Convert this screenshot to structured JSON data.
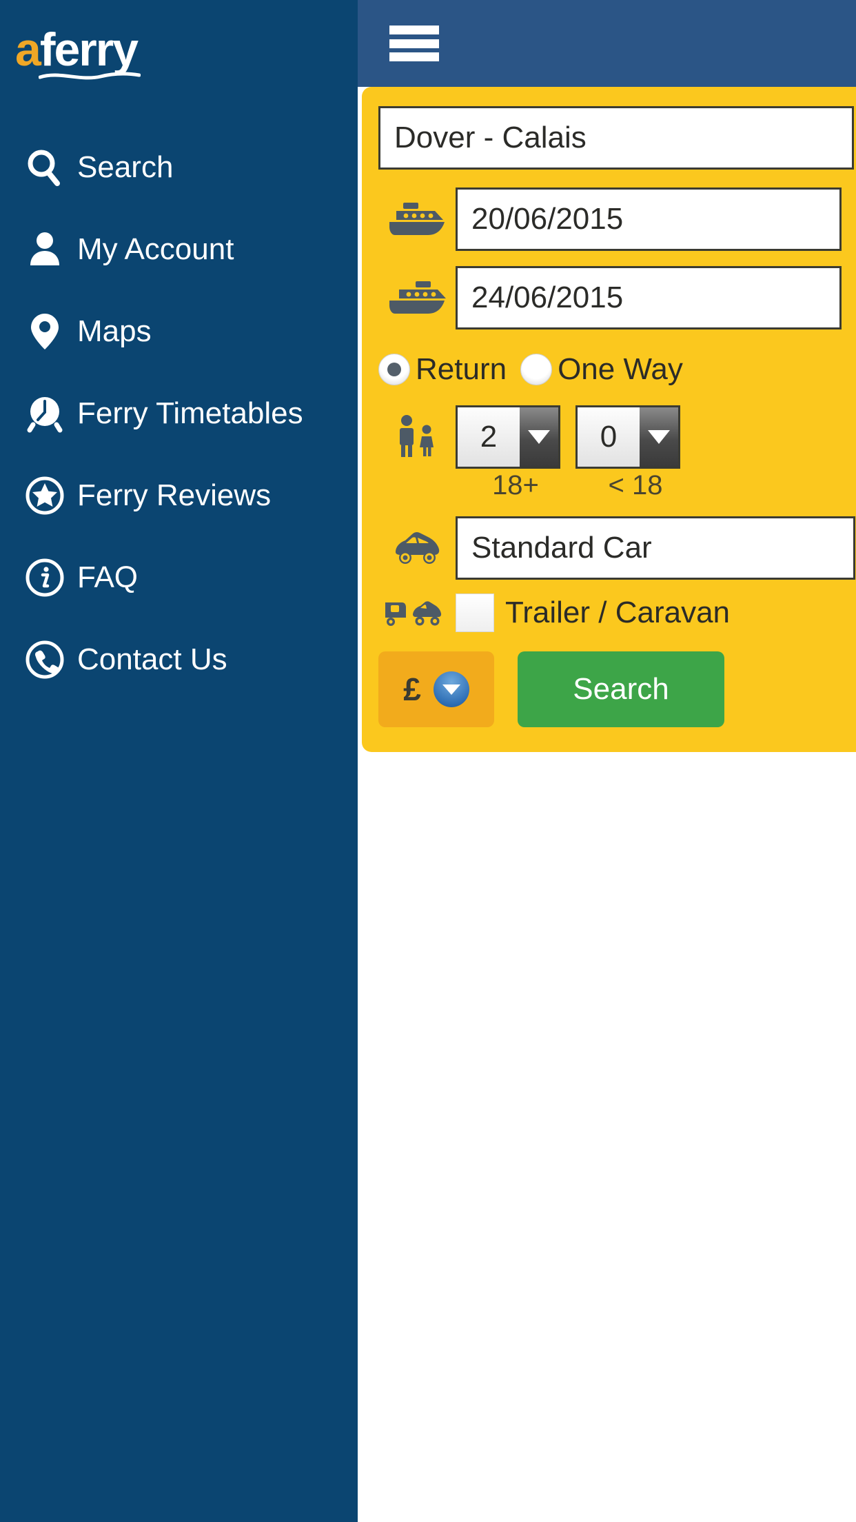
{
  "app": {
    "brand_a": "a",
    "brand_rest": "ferry"
  },
  "topbar": {
    "menu_icon": "hamburger-menu-icon"
  },
  "sidebar": {
    "items": [
      {
        "label": "Search",
        "icon": "search-icon"
      },
      {
        "label": "My Account",
        "icon": "user-icon"
      },
      {
        "label": "Maps",
        "icon": "map-pin-icon"
      },
      {
        "label": "Ferry Timetables",
        "icon": "alarm-clock-icon"
      },
      {
        "label": "Ferry Reviews",
        "icon": "star-circle-icon"
      },
      {
        "label": "FAQ",
        "icon": "info-circle-icon"
      },
      {
        "label": "Contact Us",
        "icon": "phone-circle-icon"
      }
    ]
  },
  "search_form": {
    "route": {
      "value": "Dover - Calais",
      "icon": "route-field"
    },
    "outbound": {
      "value": "20/06/2015",
      "icon": "ferry-outbound-icon"
    },
    "inbound": {
      "value": "24/06/2015",
      "icon": "ferry-inbound-icon"
    },
    "trip_type": {
      "options": [
        {
          "label": "Return",
          "selected": true
        },
        {
          "label": "One Way",
          "selected": false
        }
      ]
    },
    "passengers": {
      "icon": "adult-child-icon",
      "adults": {
        "value": "2",
        "caption": "18+"
      },
      "children": {
        "value": "0",
        "caption": "< 18"
      }
    },
    "vehicle": {
      "icon": "car-icon",
      "value": "Standard Car"
    },
    "trailer": {
      "icon": "trailer-car-icon",
      "label": "Trailer / Caravan",
      "checked": false
    },
    "currency": {
      "symbol": "£",
      "chevron": "chevron-down-icon"
    },
    "submit": {
      "label": "Search"
    }
  },
  "colors": {
    "drawer_bg": "#0b4571",
    "topbar_bg": "#2b5586",
    "card_bg": "#fbc81e",
    "brand_orange": "#f0a726",
    "submit_green": "#3da548",
    "currency_orange": "#f2ab1c",
    "icon_slate": "#4d5a66"
  }
}
